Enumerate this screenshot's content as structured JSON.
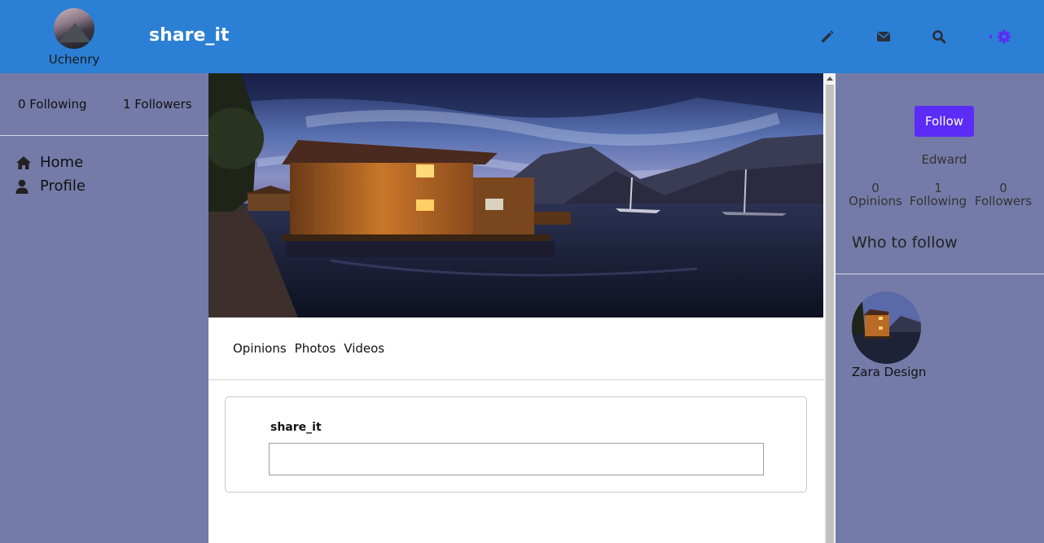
{
  "header": {
    "brand": "share_it",
    "user_name": "Uchenry",
    "icons": [
      "pencil-icon",
      "envelope-icon",
      "search-icon",
      "settings-gear-icon"
    ],
    "accent_color": "#5b2cf5",
    "bg_color": "#2b7fd4"
  },
  "left_sidebar": {
    "following": "0 Following",
    "followers": "1 Followers",
    "nav": [
      {
        "label": "Home",
        "icon": "home-icon"
      },
      {
        "label": "Profile",
        "icon": "user-icon"
      }
    ]
  },
  "main": {
    "tabs": [
      "Opinions",
      "Photos",
      "Videos"
    ],
    "composer": {
      "label": "share_it",
      "value": "",
      "placeholder": ""
    }
  },
  "right_sidebar": {
    "follow_button": "Follow",
    "profile_name": "Edward",
    "stats": [
      {
        "count": "0",
        "label": "Opinions"
      },
      {
        "count": "1",
        "label": "Following"
      },
      {
        "count": "0",
        "label": "Followers"
      }
    ],
    "who_to_follow": "Who to follow",
    "suggestions": [
      {
        "name": "Zara Design"
      }
    ]
  }
}
